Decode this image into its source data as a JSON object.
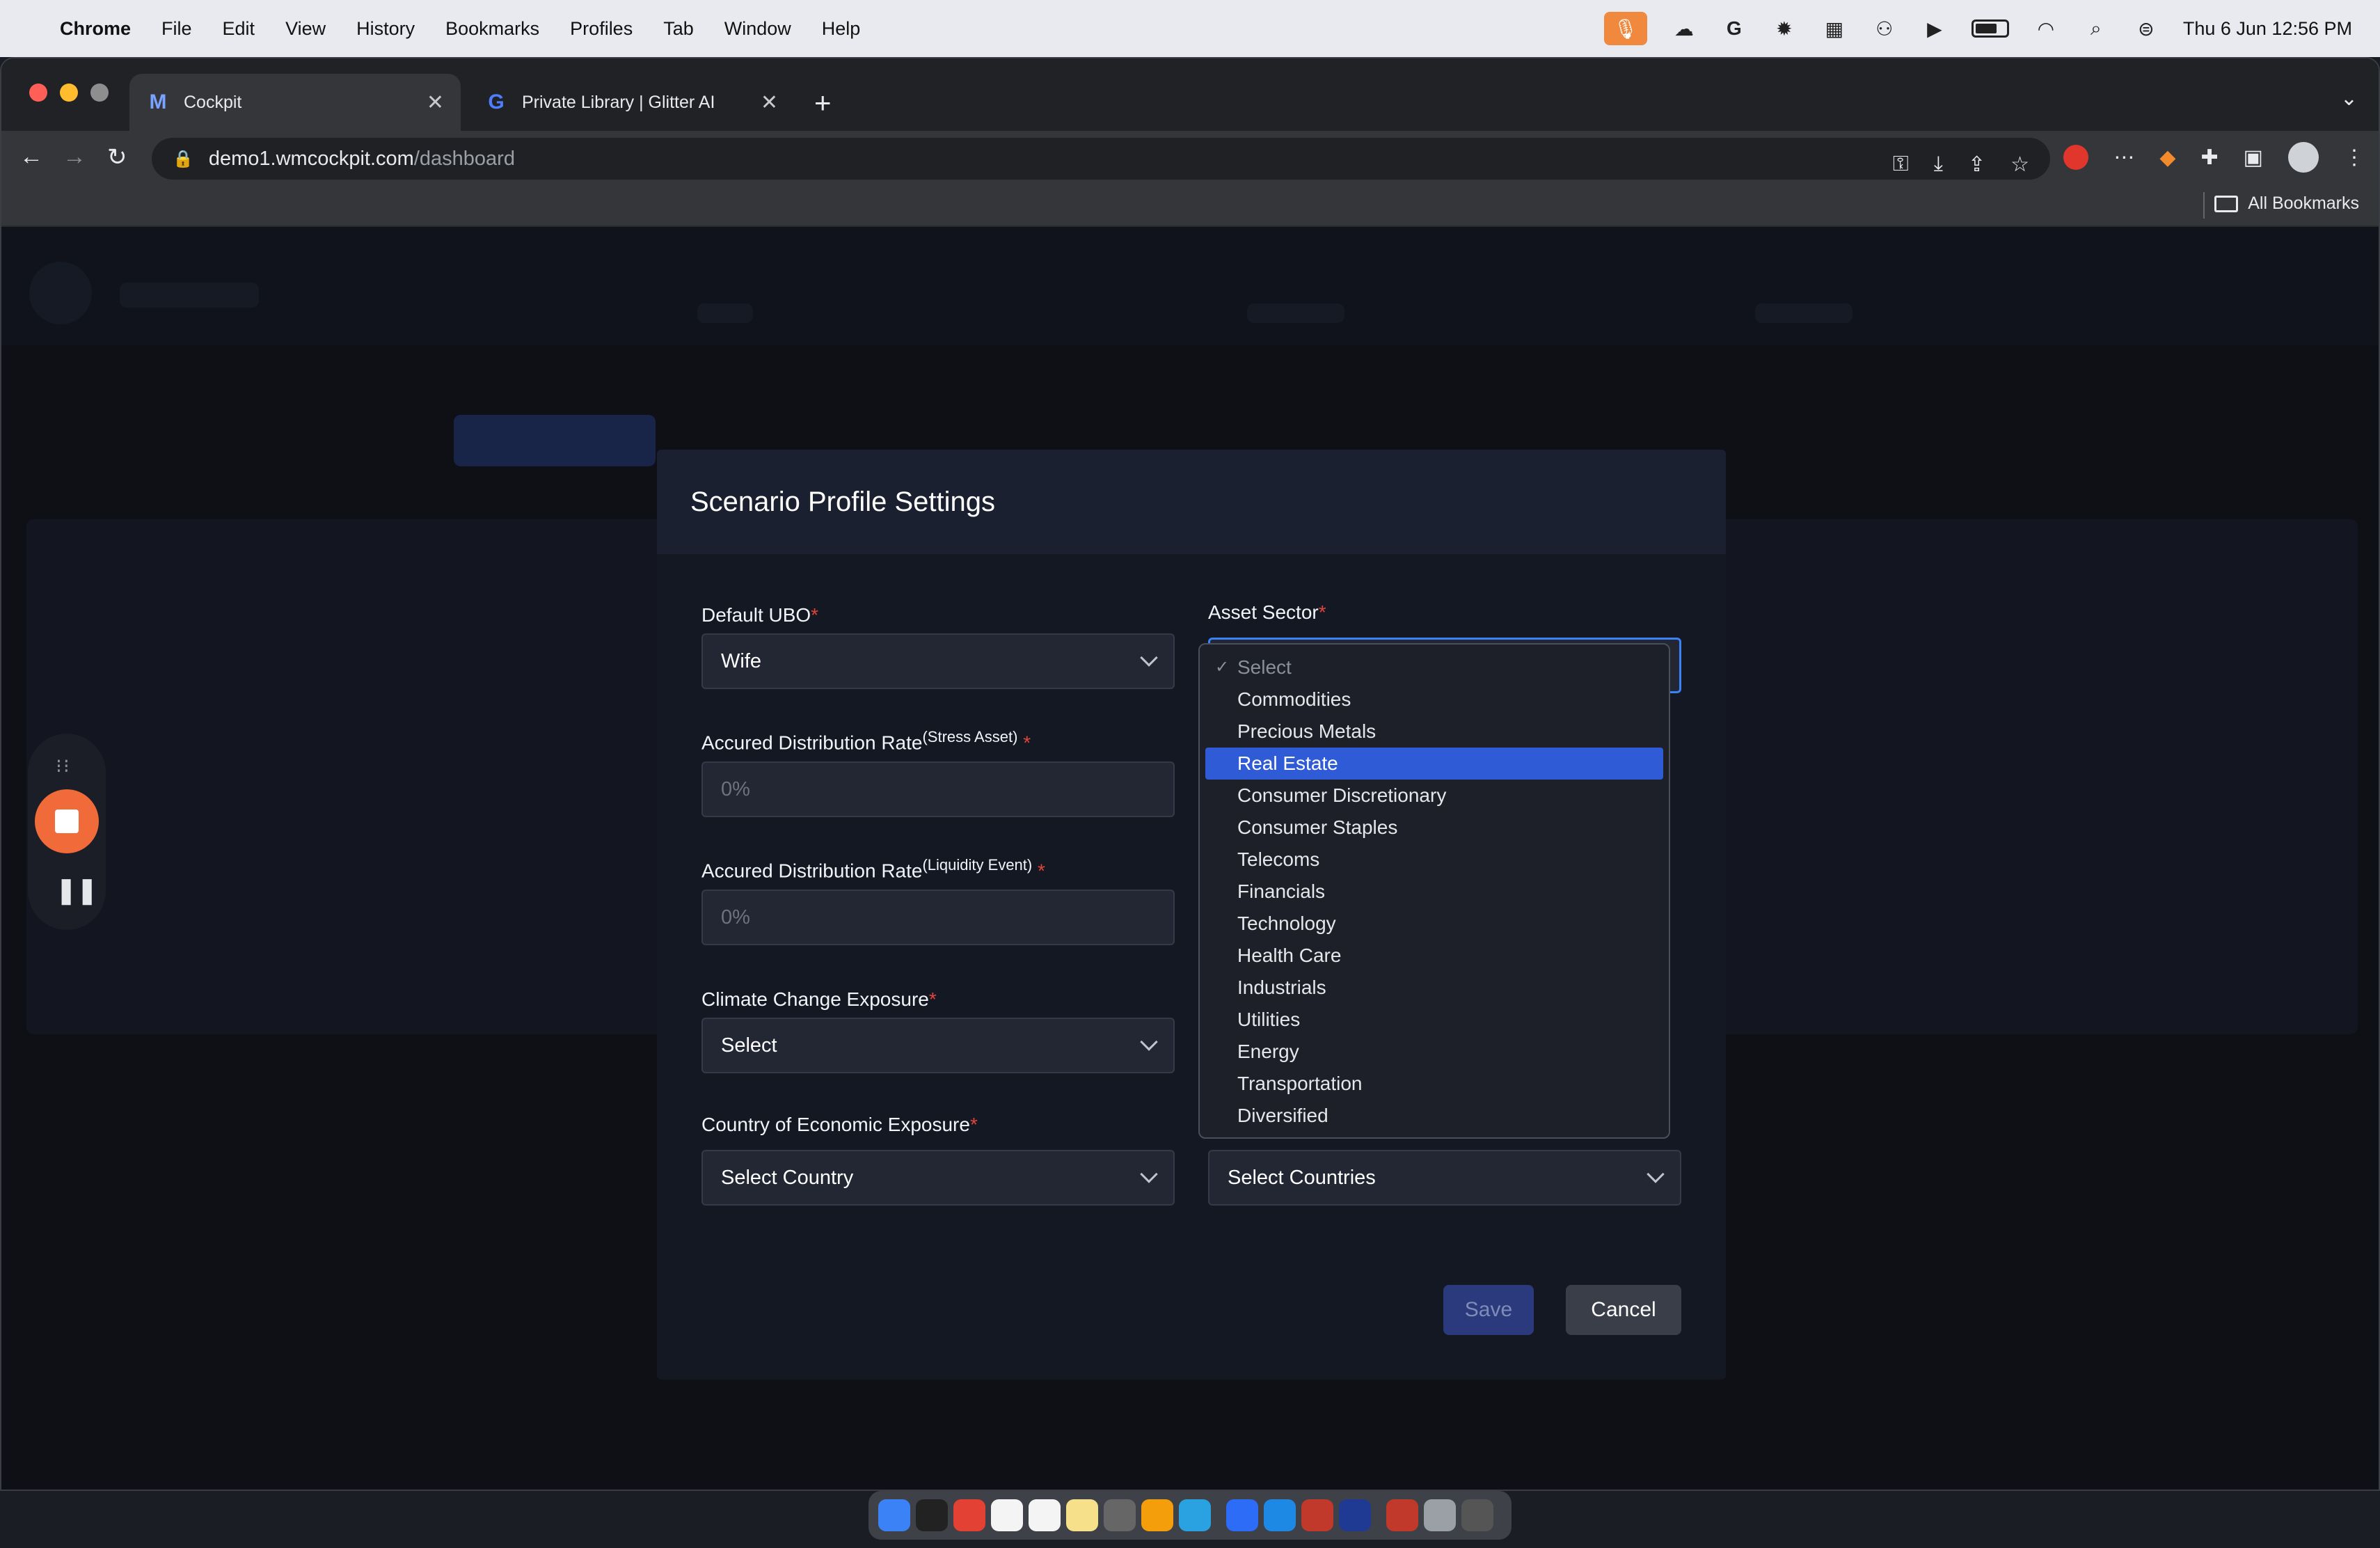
{
  "menubar": {
    "app": "Chrome",
    "items": [
      "File",
      "Edit",
      "View",
      "History",
      "Bookmarks",
      "Profiles",
      "Tab",
      "Window",
      "Help"
    ],
    "clock": "Thu 6 Jun  12:56 PM"
  },
  "browser": {
    "tabs": [
      {
        "title": "Cockpit",
        "active": true
      },
      {
        "title": "Private Library | Glitter AI",
        "active": false
      }
    ],
    "url_host": "demo1.wmcockpit.com",
    "url_path": "/dashboard",
    "bookmarks_label": "All Bookmarks"
  },
  "modal": {
    "title": "Scenario Profile Settings",
    "fields": {
      "default_ubo": {
        "label": "Default UBO",
        "value": "Wife"
      },
      "stress_rate": {
        "label": "Accured Distribution Rate",
        "sup": "(Stress Asset)",
        "placeholder": "0%"
      },
      "liquidity_rate": {
        "label": "Accured Distribution Rate",
        "sup": "(Liquidity Event)",
        "placeholder": "0%"
      },
      "climate": {
        "label": "Climate Change Exposure",
        "value": "Select"
      },
      "economic_country": {
        "label": "Country of Economic Exposure",
        "value": "Select Country"
      },
      "asset_sector": {
        "label": "Asset Sector"
      },
      "countries": {
        "value": "Select Countries"
      }
    },
    "required_marker": "*",
    "save_label": "Save",
    "cancel_label": "Cancel"
  },
  "dropdown": {
    "placeholder": "Select",
    "options": [
      "Commodities",
      "Precious Metals",
      "Real Estate",
      "Consumer Discretionary",
      "Consumer Staples",
      "Telecoms",
      "Financials",
      "Technology",
      "Health Care",
      "Industrials",
      "Utilities",
      "Energy",
      "Transportation",
      "Diversified"
    ],
    "highlighted": "Real Estate"
  },
  "colors": {
    "accent": "#2f5bd6",
    "required": "#e0453a",
    "record": "#f06a3a"
  }
}
